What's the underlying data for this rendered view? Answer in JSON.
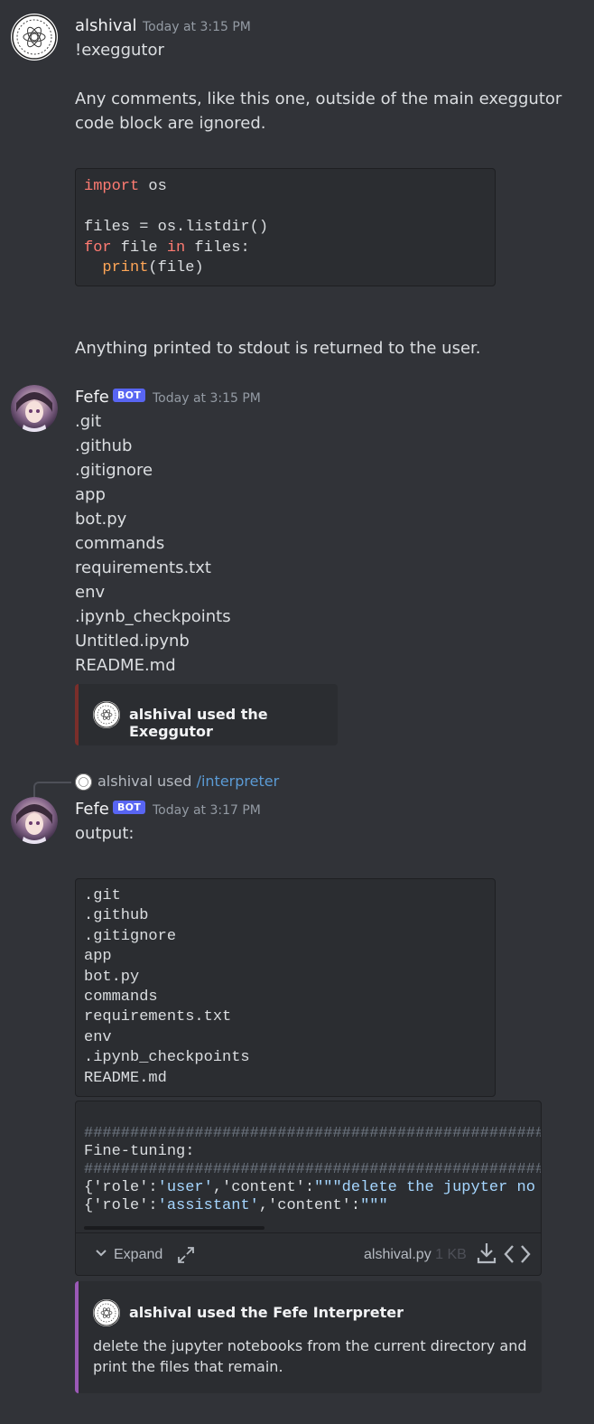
{
  "messages": {
    "m1": {
      "username": "alshival",
      "timestamp": "Today at 3:15 PM",
      "line1": "!exeggutor",
      "line2a": "Any comments, like this one, outside of the main exeggutor",
      "line2b": "code block are ignored.",
      "code": {
        "l1_kw": "import",
        "l1_rest": " os",
        "l3": "files = os.listdir()",
        "l4_kw1": "for",
        "l4_mid": " file ",
        "l4_kw2": "in",
        "l4_rest": " files:",
        "l5_fn": "print",
        "l5_rest": "(file)"
      },
      "footer": "Anything printed to stdout is returned to the user."
    },
    "m2": {
      "username": "Fefe",
      "badge": "BOT",
      "timestamp": "Today at 3:15 PM",
      "lines": [
        ".git",
        ".github",
        ".gitignore",
        "app",
        "bot.py",
        "commands",
        "requirements.txt",
        "env",
        ".ipynb_checkpoints",
        "Untitled.ipynb",
        "README.md"
      ],
      "embed_title": "alshival used the Exeggutor"
    },
    "m3": {
      "reply_user": "alshival",
      "reply_used": "used",
      "reply_command": "/interpreter",
      "username": "Fefe",
      "badge": "BOT",
      "timestamp": "Today at 3:17 PM",
      "output_label": "output:",
      "output_lines": [
        ".git",
        ".github",
        ".gitignore",
        "app",
        "bot.py",
        "commands",
        "requirements.txt",
        "env",
        ".ipynb_checkpoints",
        "README.md"
      ],
      "file_preview": {
        "hash_line": "########################################################",
        "fine_tuning": "Fine-tuning:",
        "hash_line2": "########################################################",
        "row1_a": "{'role':",
        "row1_b": "'user'",
        "row1_c": ",'content':",
        "row1_d": "\"\"\"delete the jupyter no",
        "row2_a": "{'role':",
        "row2_b": "'assistant'",
        "row2_c": ",'content':",
        "row2_d": "\"\"\""
      },
      "expand_label": "Expand",
      "file_name": "alshival.py",
      "file_size": "1 KB",
      "embed_title": "alshival used the Fefe Interpreter",
      "embed_desc_1": "delete the jupyter notebooks from the current directory and",
      "embed_desc_2": "print the files that remain."
    }
  },
  "colors": {
    "embed1_border": "#7a2e2a",
    "embed2_border": "#9b59b6",
    "bot_badge": "#5865f2"
  }
}
